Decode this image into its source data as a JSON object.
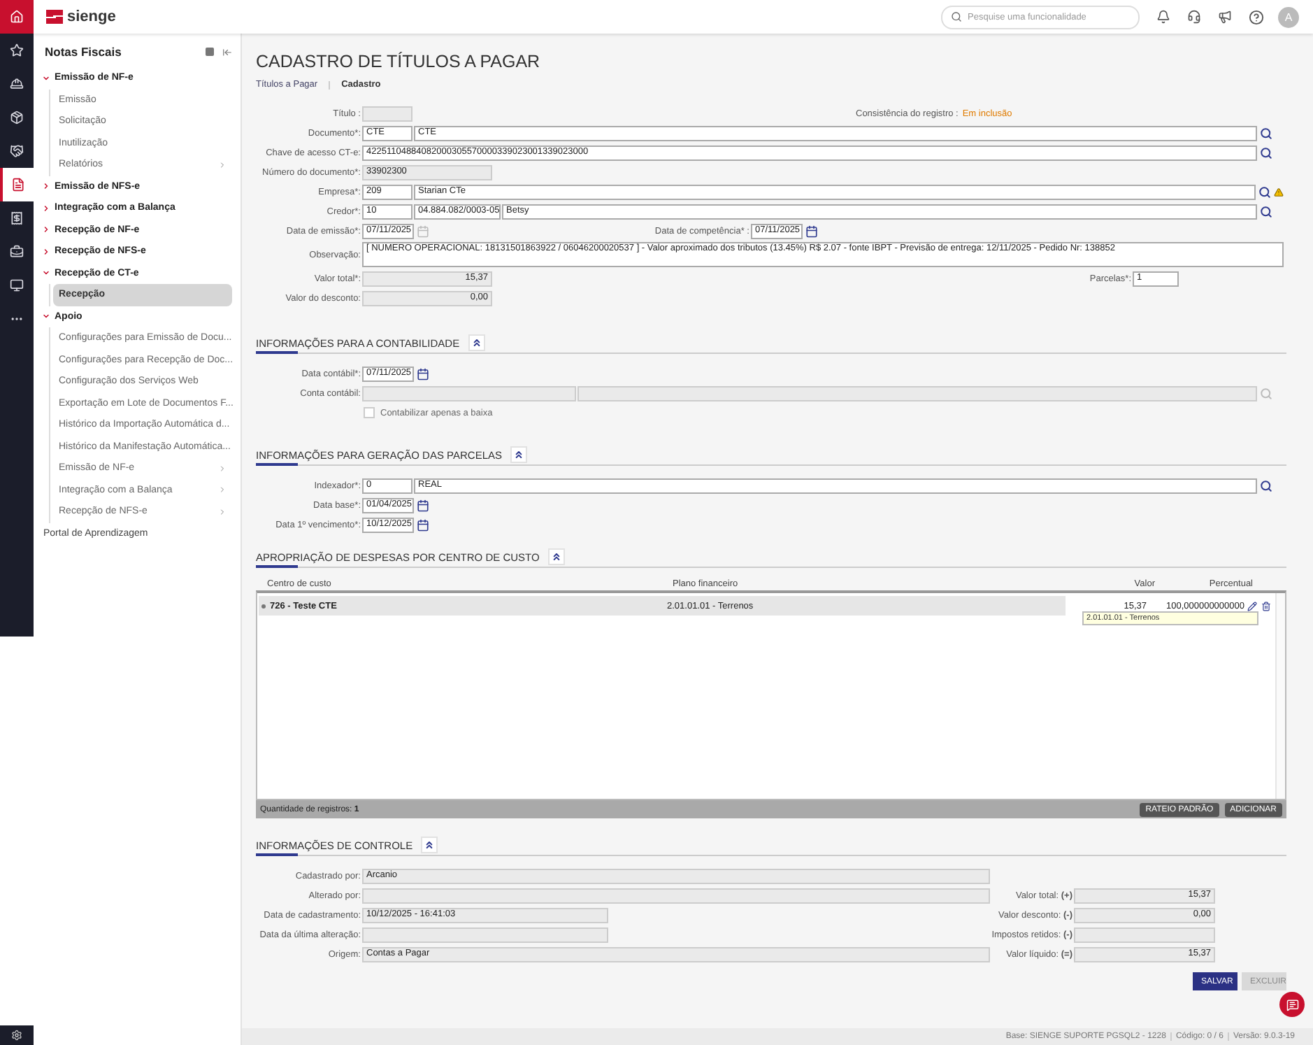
{
  "rail": [
    {
      "selected": false
    },
    {
      "selected": false
    },
    {
      "selected": false
    },
    {
      "selected": false
    },
    {
      "selected": false
    },
    {
      "selected": true
    },
    {
      "selected": false
    },
    {
      "selected": false
    },
    {
      "selected": false
    },
    {
      "selected": false
    }
  ],
  "brand": {
    "name": "sienge"
  },
  "topbar": {
    "search": {
      "placeholder": "Pesquise uma funcionalidade"
    },
    "avatar": "A"
  },
  "sidebar": {
    "title": "Notas Fiscais",
    "items": [
      {
        "label": "Emissão de NF-e",
        "expanded": true,
        "children": [
          {
            "label": "Emissão",
            "selected": false,
            "submenu": false
          },
          {
            "label": "Solicitação",
            "selected": false,
            "submenu": false
          },
          {
            "label": "Inutilização",
            "selected": false,
            "submenu": false
          },
          {
            "label": "Relatórios",
            "selected": false,
            "submenu": true
          }
        ]
      },
      {
        "label": "Emissão de NFS-e",
        "expanded": false
      },
      {
        "label": "Integração com a Balança",
        "expanded": false
      },
      {
        "label": "Recepção de NF-e",
        "expanded": false
      },
      {
        "label": "Recepção de NFS-e",
        "expanded": false
      },
      {
        "label": "Recepção de CT-e",
        "expanded": true,
        "children": [
          {
            "label": "Recepção",
            "selected": true,
            "submenu": false
          }
        ]
      },
      {
        "label": "Apoio",
        "expanded": true,
        "children": [
          {
            "label": "Configurações para Emissão de Docu...",
            "selected": false,
            "submenu": false
          },
          {
            "label": "Configurações para Recepção de Doc...",
            "selected": false,
            "submenu": false
          },
          {
            "label": "Configuração dos Serviços Web",
            "selected": false,
            "submenu": false
          },
          {
            "label": "Exportação em Lote de Documentos F...",
            "selected": false,
            "submenu": false
          },
          {
            "label": "Histórico da Importação Automática d...",
            "selected": false,
            "submenu": false
          },
          {
            "label": "Histórico da Manifestação Automática...",
            "selected": false,
            "submenu": false
          },
          {
            "label": "Emissão de NF-e",
            "selected": false,
            "submenu": true
          },
          {
            "label": "Integração com a Balança",
            "selected": false,
            "submenu": true
          },
          {
            "label": "Recepção de NFS-e",
            "selected": false,
            "submenu": true
          }
        ]
      }
    ],
    "footer_link": "Portal de Aprendizagem"
  },
  "page": {
    "title": "CADASTRO DE TÍTULOS A PAGAR",
    "breadcrumb": [
      {
        "label": "Títulos a Pagar",
        "current": false
      },
      {
        "label": "Cadastro",
        "current": true
      }
    ]
  },
  "form": {
    "title_field": {
      "label": "Título :"
    },
    "consistency": {
      "label": "Consistência do registro :",
      "value": "Em inclusão"
    },
    "document": {
      "label": "Documento*:",
      "code": "CTE",
      "description": "CTE"
    },
    "access_key": {
      "label": "Chave de acesso CT-e:",
      "value": "42251104884082000305570000339023001339023000"
    },
    "doc_number": {
      "label": "Número do documento*:",
      "value": "33902300"
    },
    "company": {
      "label": "Empresa*:",
      "code": "209",
      "description": "Starian CTe",
      "warning": true
    },
    "creditor": {
      "label": "Credor*:",
      "code": "10",
      "tax_id": "04.884.082/0003-05",
      "name": "Betsy"
    },
    "issue_date": {
      "label": "Data de emissão*:",
      "value": "07/11/2025",
      "calendar_disabled": true
    },
    "competence_date": {
      "label": "Data de competência* :",
      "value": "07/11/2025",
      "calendar_disabled": false
    },
    "notes": {
      "label": "Observação:",
      "value": "[  NUMERO OPERACIONAL: 18131501863922 / 06046200020537  ]   -    Valor aproximado dos tributos (13.45%)  R$ 2.07  -  fonte IBPT - Previsão de entrega: 12/11/2025 - Pedido Nr: 138852"
    },
    "total": {
      "label": "Valor total*:",
      "value": "15,37"
    },
    "installments": {
      "label": "Parcelas*:",
      "value": "1"
    },
    "discount": {
      "label": "Valor do desconto:",
      "value": "0,00"
    }
  },
  "accounting": {
    "title": "INFORMAÇÕES PARA A CONTABILIDADE",
    "expanded": true,
    "date": {
      "label": "Data contábil*:",
      "value": "07/11/2025",
      "calendar_disabled": false
    },
    "account": {
      "label": "Conta contábil:"
    },
    "checkbox": {
      "label": "Contabilizar apenas a baixa",
      "checked": false,
      "disabled": true
    }
  },
  "installments_section": {
    "title": "INFORMAÇÕES PARA GERAÇÃO DAS PARCELAS",
    "expanded": true,
    "indexer": {
      "label": "Indexador*:",
      "code": "0",
      "description": "REAL"
    },
    "base_date": {
      "label": "Data base*:",
      "value": "01/04/2025",
      "calendar_disabled": false
    },
    "first_due": {
      "label": "Data 1º vencimento*:",
      "value": "10/12/2025",
      "calendar_disabled": false
    }
  },
  "allocation": {
    "title": "APROPRIAÇÃO DE DESPESAS POR CENTRO DE CUSTO",
    "expanded": true,
    "columns": [
      "Centro de custo",
      "Plano financeiro",
      "Valor",
      "Percentual"
    ],
    "rows": [
      {
        "cost_center": "726 - Teste CTE",
        "plan": "2.01.01.01 - Terrenos",
        "value": "15,37",
        "percent": "100,000000000000"
      }
    ],
    "tooltip": "2.01.01.01 - Terrenos",
    "count": "Quantidade de registros: **1**",
    "buttons": [
      "RATEIO PADRÃO",
      "ADICIONAR"
    ]
  },
  "control": {
    "title": "INFORMAÇÕES DE CONTROLE",
    "expanded": true,
    "left": [
      {
        "label": "Cadastrado por:",
        "value": "Arcanio",
        "wide": true
      },
      {
        "label": "Alterado por:",
        "wide": true
      },
      {
        "label": "Data de cadastramento:",
        "value": "10/12/2025 - 16:41:03",
        "wide": false
      },
      {
        "label": "Data da última alteração:",
        "wide": false
      },
      {
        "label": "Origem:",
        "value": "Contas a Pagar",
        "wide": true
      }
    ],
    "right": [
      {
        "label": "Valor total:",
        "sign": "(+)",
        "value": "15,37"
      },
      {
        "label": "Valor desconto:",
        "sign": "(-)",
        "value": "0,00"
      },
      {
        "label": "Impostos retidos:",
        "sign": "(-)"
      },
      {
        "label": "Valor líquido:",
        "sign": "(=)",
        "value": "15,37"
      }
    ],
    "buttons": [
      {
        "label": "SALVAR",
        "disabled": false
      },
      {
        "label": "EXCLUIR",
        "disabled": true
      }
    ]
  },
  "status_bar": [
    "Base: SIENGE SUPORTE PGSQL2 - 1228",
    "Código: 0 / 6",
    "Versão: 9.0.3-19"
  ]
}
